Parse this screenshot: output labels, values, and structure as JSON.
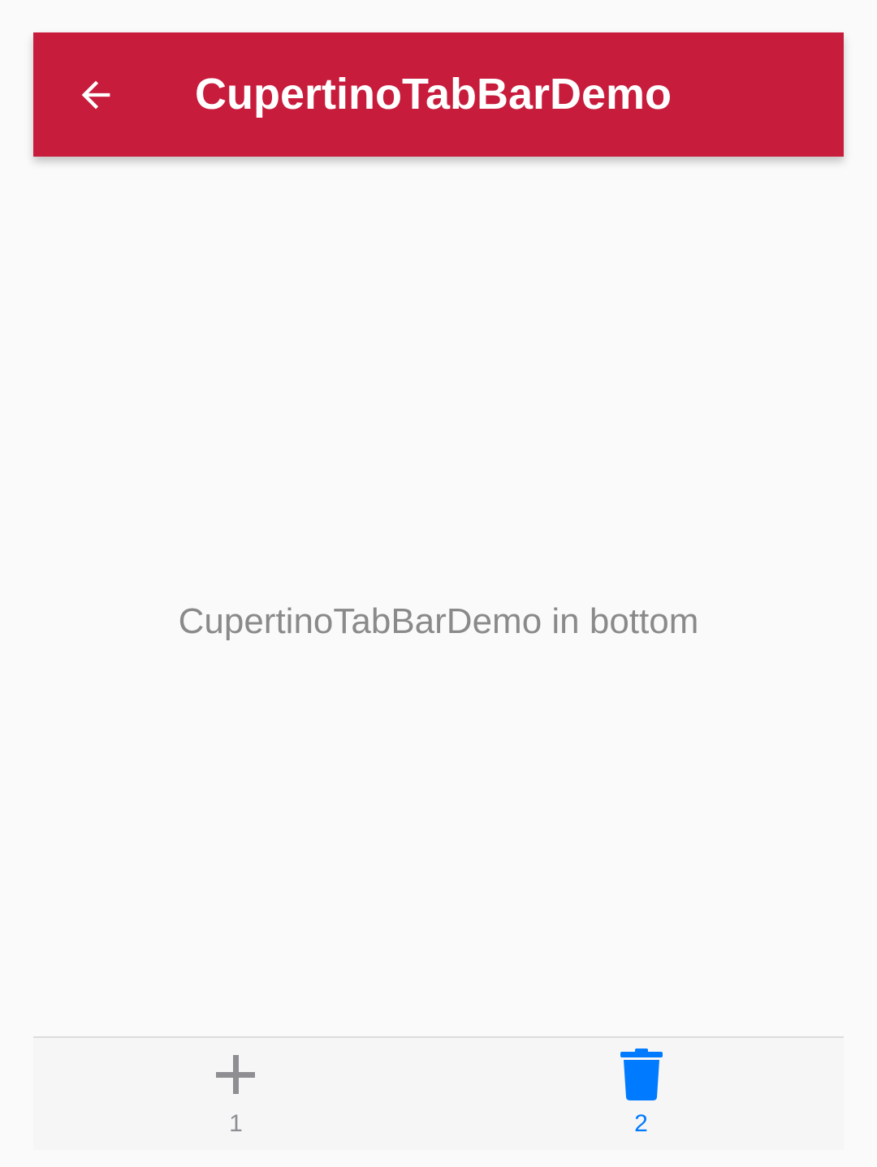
{
  "app_bar": {
    "title": "CupertinoTabBarDemo",
    "back_icon": "arrow-back-icon",
    "background_color": "#c81c3c"
  },
  "body": {
    "text": "CupertinoTabBarDemo in bottom"
  },
  "tab_bar": {
    "tabs": [
      {
        "label": "1",
        "icon": "add-icon",
        "active": false,
        "color": "#8e8e93"
      },
      {
        "label": "2",
        "icon": "trash-icon",
        "active": true,
        "color": "#007aff"
      }
    ]
  }
}
